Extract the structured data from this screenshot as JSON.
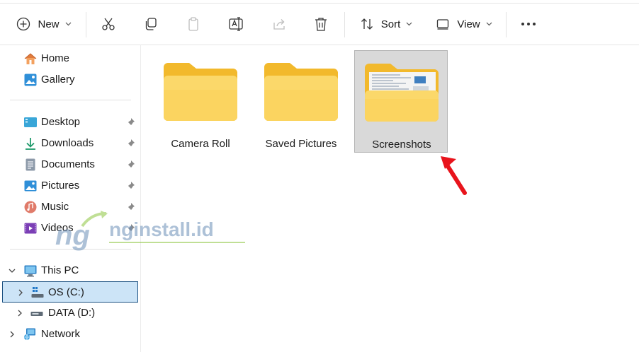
{
  "toolbar": {
    "new_label": "New",
    "sort_label": "Sort",
    "view_label": "View"
  },
  "sidebar": {
    "items": [
      {
        "label": "Home",
        "icon": "home-icon"
      },
      {
        "label": "Gallery",
        "icon": "gallery-icon"
      },
      {
        "label": "Desktop",
        "icon": "desktop-icon",
        "pinned": true
      },
      {
        "label": "Downloads",
        "icon": "downloads-icon",
        "pinned": true
      },
      {
        "label": "Documents",
        "icon": "documents-icon",
        "pinned": true
      },
      {
        "label": "Pictures",
        "icon": "pictures-icon",
        "pinned": true
      },
      {
        "label": "Music",
        "icon": "music-icon",
        "pinned": true
      },
      {
        "label": "Videos",
        "icon": "videos-icon",
        "pinned": true
      },
      {
        "label": "This PC",
        "icon": "computer-icon",
        "expanded": true
      },
      {
        "label": "OS (C:)",
        "icon": "drive-c-icon",
        "selected": true
      },
      {
        "label": "DATA  (D:)",
        "icon": "drive-d-icon"
      },
      {
        "label": "Network",
        "icon": "network-icon"
      }
    ]
  },
  "folders": [
    {
      "name": "Camera Roll"
    },
    {
      "name": "Saved Pictures"
    },
    {
      "name": "Screenshots",
      "selected": true
    }
  ],
  "watermark": {
    "text": "nginstall.id",
    "logo": "ng"
  },
  "colors": {
    "folder_yellow": "#f8c93b",
    "folder_light": "#fbe38a",
    "selection_blue": "#cce4f7",
    "arrow_red": "#e8141c",
    "watermark_green": "#8dc63f"
  }
}
